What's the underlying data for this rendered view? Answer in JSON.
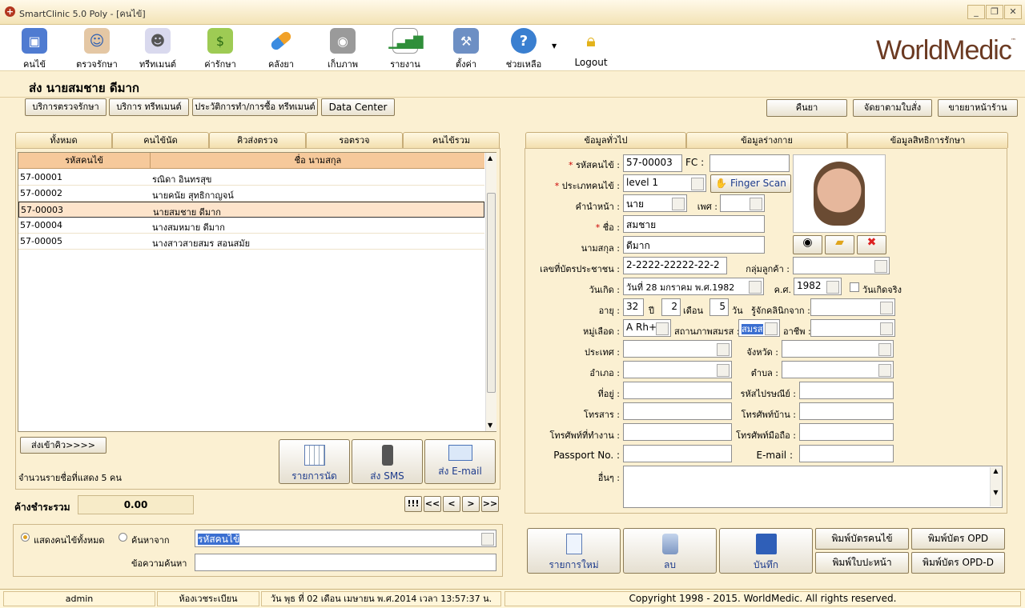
{
  "window": {
    "title": "SmartClinic 5.0 Poly - [คนไข้]"
  },
  "toolbar": {
    "items": [
      "คนไข้",
      "ตรวจรักษา",
      "ทรีทเมนต์",
      "ค่ารักษา",
      "คลังยา",
      "เก็บภาพ",
      "รายงาน",
      "ตั้งค่า",
      "ช่วยเหลือ",
      "Logout"
    ]
  },
  "brand": "WorldMedic",
  "patient_title": "ส่ง  นายสมชาย ดีมาก",
  "action_buttons": [
    "บริการตรวจรักษา",
    "บริการ ทรีทเมนต์",
    "ประวัติการทำ/การซื้อ ทรีทเมนต์",
    "Data Center"
  ],
  "right_buttons": [
    "คืนยา",
    "จัดยาตามใบสั่ง",
    "ขายยาหน้าร้าน"
  ],
  "left_tabs": [
    "ทั้งหมด",
    "คนไข้นัด",
    "คิวส่งตรวจ",
    "รอตรวจ",
    "คนไข้รวม"
  ],
  "grid": {
    "headers": [
      "รหัสคนไข้",
      "ชื่อ นามสกุล"
    ],
    "rows": [
      {
        "id": "57-00001",
        "name": "รณิดา อินทรสุข"
      },
      {
        "id": "57-00002",
        "name": "นายคนัย สุทธิกาญจน์"
      },
      {
        "id": "57-00003",
        "name": "นายสมชาย ดีมาก"
      },
      {
        "id": "57-00004",
        "name": "นางสมหมาย ดีมาก"
      },
      {
        "id": "57-00005",
        "name": "นางสาวสายสมร สอนสมัย"
      }
    ]
  },
  "queue_button": "ส่งเข้าคิว>>>>",
  "count_text": "จำนวนรายชื่อที่แสดง 5 คน",
  "big_left": [
    "รายการนัด",
    "ส่ง SMS",
    "ส่ง E-mail"
  ],
  "balance": {
    "label": "ค้างชำระรวม",
    "value": "0.00"
  },
  "nav": [
    "!!!",
    "<<",
    "<",
    ">",
    ">>"
  ],
  "search": {
    "opt_all": "แสดงคนไข้ทั้งหมด",
    "opt_find": "ค้นหาจาก",
    "field": "รหัสคนไข้",
    "kw_label": "ข้อความค้นหา"
  },
  "right_tabs": [
    "ข้อมูลทั่วไป",
    "ข้อมูลร่างกาย",
    "ข้อมูลสิทธิการรักษา"
  ],
  "form": {
    "hn_label": "รหัสคนไข้ :",
    "hn": "57-00003",
    "fc_label": "FC :",
    "type_label": "ประเภทคนไข้ :",
    "type": "level 1",
    "finger": "Finger Scan",
    "prefix_label": "คำนำหน้า :",
    "prefix": "นาย",
    "sex_label": "เพศ :",
    "fname_label": "ชื่อ :",
    "fname": "สมชาย",
    "lname_label": "นามสกุล :",
    "lname": "ดีมาก",
    "idcard_label": "เลขที่บัตรประชาชน :",
    "idcard": "2-2222-22222-22-2",
    "group_label": "กลุ่มลูกค้า :",
    "birth_label": "วันเกิด :",
    "birth": "วันที่ 28  มกราคม  พ.ศ.1982",
    "ad_label": "ค.ศ.",
    "ad": "1982",
    "realbd": "วันเกิดจริง",
    "age_label": "อายุ :",
    "age_y": "32",
    "y": "ปี",
    "age_m": "2",
    "m": "เดือน",
    "age_d": "5",
    "d": "วัน",
    "know_label": "รู้จักคลินิกจาก :",
    "blood_label": "หมู่เลือด :",
    "blood": "A  Rh+",
    "marital_label": "สถานภาพสมรส :",
    "marital": "สมรส",
    "job_label": "อาชีพ :",
    "country_label": "ประเทศ :",
    "province_label": "จังหวัด :",
    "district_label": "อำเภอ :",
    "sub_label": "ตำบล :",
    "addr_label": "ที่อยู่ :",
    "zip_label": "รหัสไปรษณีย์ :",
    "fax_label": "โทรสาร :",
    "home_label": "โทรศัพท์บ้าน :",
    "work_label": "โทรศัพท์ที่ทำงาน :",
    "mobile_label": "โทรศัพท์มือถือ :",
    "passport_label": "Passport No. :",
    "email_label": "E-mail :",
    "other_label": "อื่นๆ :"
  },
  "bottom_big": [
    "รายการใหม่",
    "ลบ",
    "บันทึก"
  ],
  "print_buttons": [
    "พิมพ์บัตรคนไข้",
    "พิมพ์บัตร OPD",
    "พิมพ์ใบปะหน้า",
    "พิมพ์บัตร OPD-D"
  ],
  "status": {
    "user": "admin",
    "room": "ห้องเวชระเบียน",
    "datetime": "วัน พุธ ที่ 02 เดือน เมษายน พ.ศ.2014 เวลา 13:57:37 น.",
    "copyright": "Copyright 1998 - 2015. WorldMedic. All rights reserved."
  },
  "colors": {
    "accent": "#f6c99b",
    "bg": "#fbf0d2",
    "brand": "#6b3a22"
  }
}
